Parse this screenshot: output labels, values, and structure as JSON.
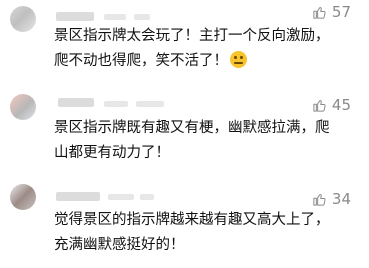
{
  "comments": [
    {
      "likes": "57",
      "line1": "景区指示牌太会玩了！主打一个反向激励，",
      "line2": "爬不动也得爬，笑不活了！",
      "has_emoji": true
    },
    {
      "likes": "45",
      "line1": "景区指示牌既有趣又有梗，幽默感拉满，爬",
      "line2": "山都更有动力了！"
    },
    {
      "likes": "34",
      "line1": "觉得景区的指示牌越来越有趣又高大上了，",
      "line2": "充满幽默感挺好的！"
    }
  ],
  "icons": {
    "like": "thumbs-up-icon",
    "emoji": "laughing-face-emoji-icon"
  },
  "colors": {
    "count": "#8a8a8a",
    "text": "#111111"
  }
}
